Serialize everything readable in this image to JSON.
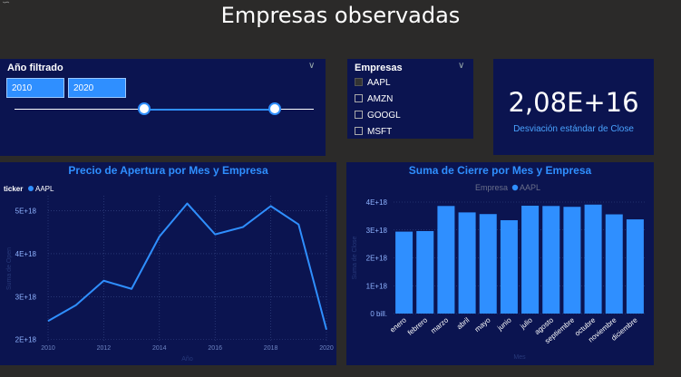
{
  "page": {
    "title": "Empresas observadas"
  },
  "year_slicer": {
    "title": "Año filtrado",
    "start": "2010",
    "end": "2020"
  },
  "companies": {
    "title": "Empresas",
    "items": [
      {
        "label": "AAPL",
        "checked": true
      },
      {
        "label": "AMZN",
        "checked": false
      },
      {
        "label": "GOOGL",
        "checked": false
      },
      {
        "label": "MSFT",
        "checked": false
      }
    ]
  },
  "kpi": {
    "value": "2,08E+16",
    "label": "Desviación estándar de Close"
  },
  "colors": {
    "accent": "#2f8fff",
    "panel": "#0b1450",
    "background": "#2b2a29"
  },
  "chart_data": [
    {
      "type": "line",
      "title": "Precio de Apertura por Mes y Empresa",
      "legend_title": "ticker",
      "legend_position": "top-left",
      "xlabel": "Año",
      "ylabel": "Suma de Open",
      "x_ticks": [
        "2010",
        "2012",
        "2014",
        "2016",
        "2018",
        "2020"
      ],
      "y_ticks": [
        "2E+18",
        "3E+18",
        "4E+18",
        "5E+18"
      ],
      "xlim": [
        2010,
        2020
      ],
      "ylim": [
        1.95e+18,
        5.35e+18
      ],
      "series": [
        {
          "name": "AAPL",
          "x": [
            2010,
            2011,
            2012,
            2013,
            2014,
            2015,
            2016,
            2017,
            2018,
            2019,
            2020
          ],
          "values": [
            2.43e+18,
            2.8e+18,
            3.37e+18,
            3.18e+18,
            4.4e+18,
            5.17e+18,
            4.45e+18,
            4.62e+18,
            5.11e+18,
            4.68e+18,
            2.23e+18
          ]
        }
      ],
      "grid": true
    },
    {
      "type": "bar",
      "title": "Suma de Cierre por Mes y Empresa",
      "legend_title": "Empresa",
      "legend_position": "top-center",
      "xlabel": "Mes",
      "ylabel": "Suma de Close",
      "categories": [
        "enero",
        "febrero",
        "marzo",
        "abril",
        "mayo",
        "junio",
        "julio",
        "agosto",
        "septiembre",
        "octubre",
        "noviembre",
        "diciembre"
      ],
      "y_ticks": [
        "0 bill.",
        "1E+18",
        "2E+18",
        "3E+18",
        "4E+18"
      ],
      "ylim": [
        0,
        4e+18
      ],
      "series": [
        {
          "name": "AAPL",
          "values": [
            2.94e+18,
            2.96e+18,
            3.86e+18,
            3.63e+18,
            3.57e+18,
            3.35e+18,
            3.87e+18,
            3.86e+18,
            3.83e+18,
            3.91e+18,
            3.56e+18,
            3.38e+18
          ]
        }
      ],
      "grid": true
    }
  ]
}
